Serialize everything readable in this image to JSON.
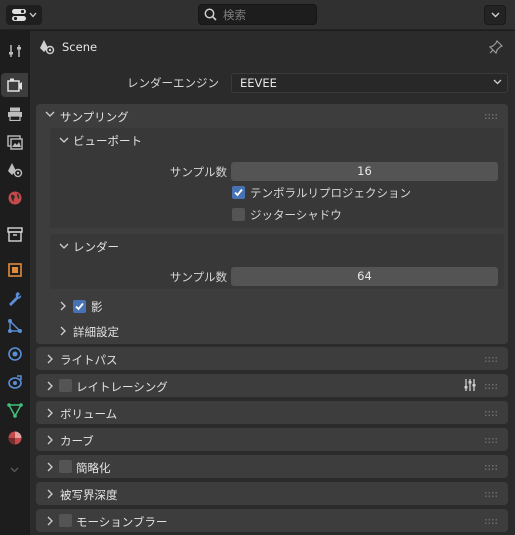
{
  "header": {
    "search_placeholder": "検索"
  },
  "context": {
    "label": "Scene"
  },
  "render_engine": {
    "label": "レンダーエンジン",
    "value": "EEVEE"
  },
  "sampling": {
    "title": "サンプリング",
    "viewport": {
      "title": "ビューポート",
      "samples_label": "サンプル数",
      "samples_value": "16",
      "temporal_reprojection_label": "テンポラルリプロジェクション",
      "temporal_reprojection_checked": true,
      "jitter_shadows_label": "ジッターシャドウ",
      "jitter_shadows_checked": false
    },
    "render": {
      "title": "レンダー",
      "samples_label": "サンプル数",
      "samples_value": "64"
    },
    "shadows": {
      "title": "影",
      "checked": true
    },
    "advanced": {
      "title": "詳細設定"
    }
  },
  "panels": [
    {
      "title": "ライトパス",
      "has_checkbox": false
    },
    {
      "title": "レイトレーシング",
      "has_checkbox": true
    },
    {
      "title": "ボリューム",
      "has_checkbox": false
    },
    {
      "title": "カーブ",
      "has_checkbox": false
    },
    {
      "title": "簡略化",
      "has_checkbox": true
    },
    {
      "title": "被写界深度",
      "has_checkbox": false
    },
    {
      "title": "モーションブラー",
      "has_checkbox": true
    }
  ],
  "colors": {
    "accent": "#4772b3",
    "panel": "#3d3d3d",
    "background": "#2b2b2b"
  },
  "sidebar_tabs": [
    "tool-icon",
    "render-icon",
    "output-icon",
    "view-layer-icon",
    "scene-icon",
    "world-icon",
    "collection-icon",
    "object-icon",
    "modifier-icon",
    "particles-icon",
    "physics-icon",
    "constraints-icon",
    "data-icon",
    "material-icon",
    "expand-icon"
  ]
}
